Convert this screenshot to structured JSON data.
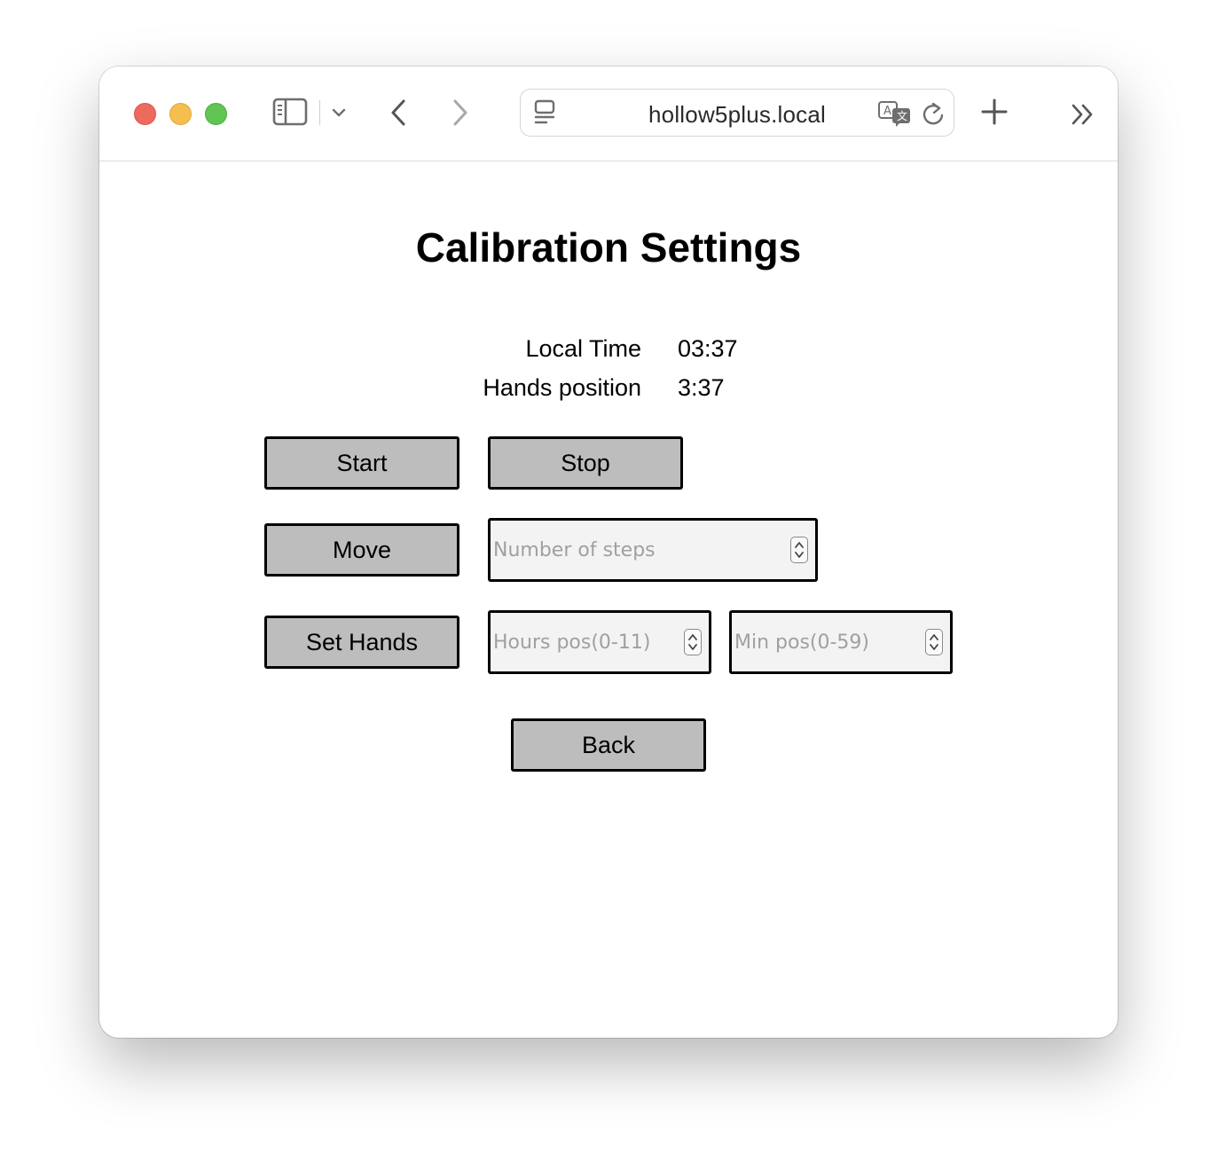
{
  "browser": {
    "url": "hollow5plus.local",
    "icons": {
      "sidebar": "sidebar-icon",
      "tabs_menu": "chevron-down-icon",
      "back": "back-arrow-icon",
      "forward": "forward-arrow-icon",
      "page_menu": "page-menu-icon",
      "translate": "translate-icon",
      "reload": "reload-icon",
      "new_tab": "plus-icon",
      "overflow": "double-chevron-icon"
    }
  },
  "page": {
    "title": "Calibration Settings",
    "local_time_label": "Local Time",
    "local_time_value": "03:37",
    "hands_position_label": "Hands position",
    "hands_position_value": "3:37"
  },
  "controls": {
    "start_label": "Start",
    "stop_label": "Stop",
    "move_label": "Move",
    "steps_placeholder": "Number of steps",
    "set_hands_label": "Set Hands",
    "hours_placeholder": "Hours pos(0-11)",
    "minutes_placeholder": "Min pos(0-59)",
    "back_label": "Back"
  },
  "colors": {
    "button_bg": "#bdbdbd",
    "input_bg": "#f3f3f3",
    "traffic_red": "#ed6a5e",
    "traffic_yellow": "#f5bf4f",
    "traffic_green": "#61c554"
  }
}
